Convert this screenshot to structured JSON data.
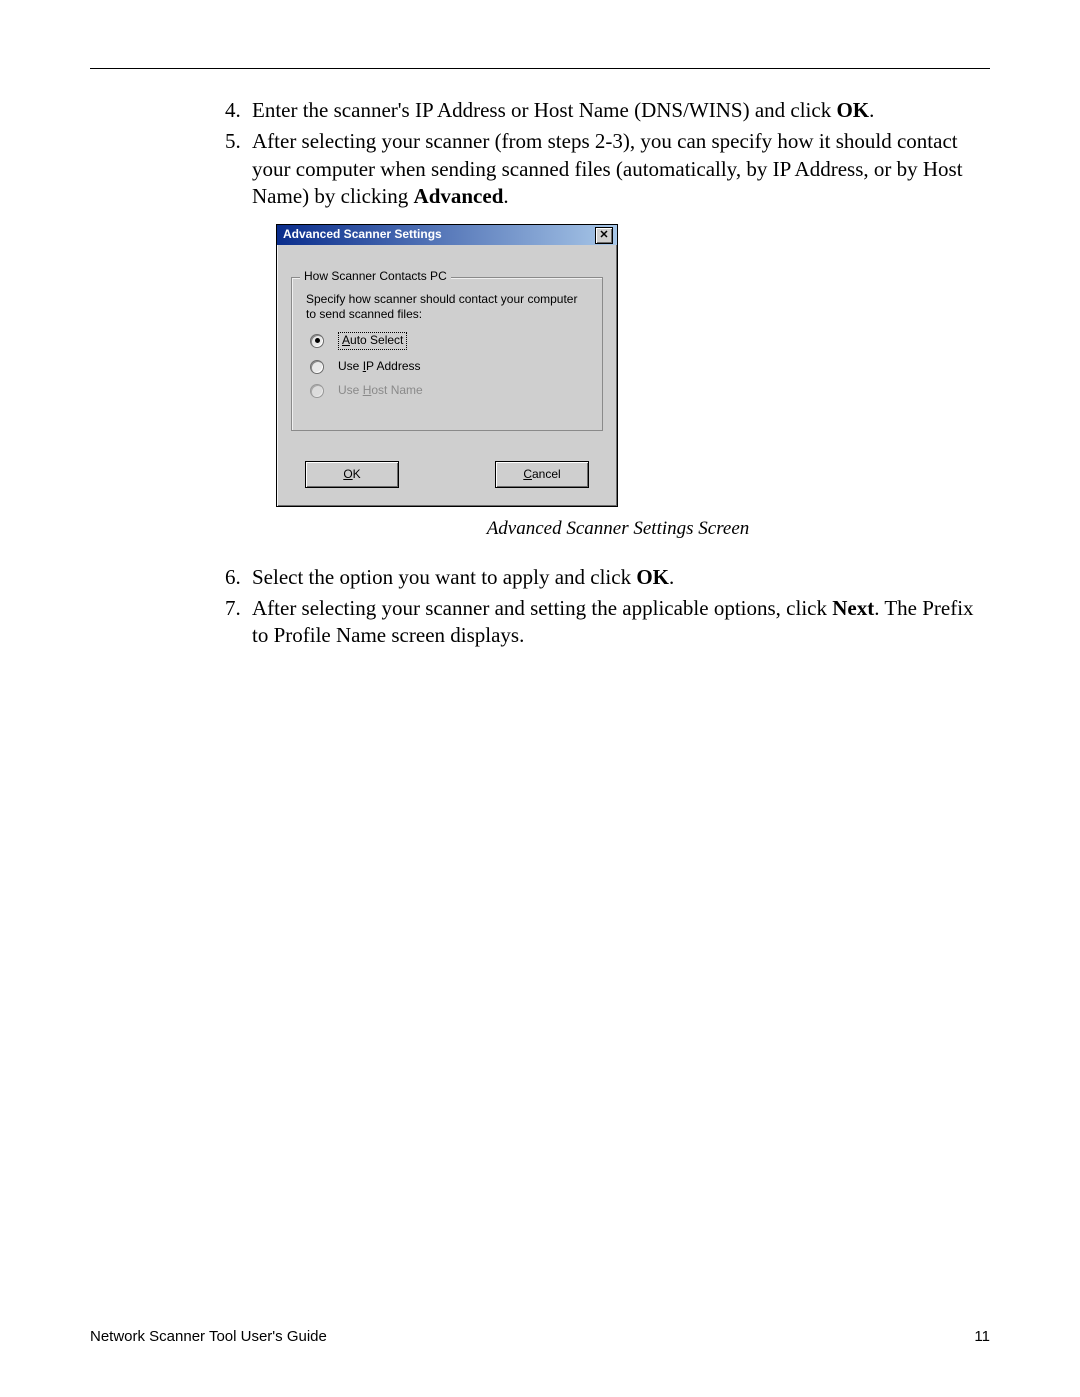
{
  "steps": {
    "s4": {
      "num": "4",
      "text_a": "Enter the scanner's IP Address or Host Name (DNS/WINS) and click ",
      "bold_a": "OK",
      "text_b": "."
    },
    "s5": {
      "num": "5",
      "text_a": "After selecting your scanner (from steps 2-3), you can specify how it should contact your computer when sending scanned files (automatically, by IP Address, or by Host Name) by clicking ",
      "bold_a": "Advanced",
      "text_b": "."
    },
    "s6": {
      "num": "6",
      "text_a": "Select the option you want to apply and click ",
      "bold_a": "OK",
      "text_b": "."
    },
    "s7": {
      "num": "7",
      "text_a": "After selecting your scanner and setting the applicable options, click ",
      "bold_a": "Next",
      "text_b": ". The Prefix to Profile Name screen displays."
    }
  },
  "dialog": {
    "title": "Advanced Scanner Settings",
    "close_glyph": "✕",
    "group_legend": "How Scanner Contacts PC",
    "group_desc": "Specify how scanner should contact your computer to send scanned files:",
    "opt1_u": "A",
    "opt1_rest": "uto Select",
    "opt2_pre": "Use ",
    "opt2_u": "I",
    "opt2_rest": "P Address",
    "opt3_pre": "Use ",
    "opt3_u": "H",
    "opt3_rest": "ost Name",
    "ok_u": "O",
    "ok_rest": "K",
    "cancel_u": "C",
    "cancel_rest": "ancel"
  },
  "caption": "Advanced Scanner Settings Screen",
  "footer": {
    "left": "Network Scanner Tool User's Guide",
    "right": "11"
  }
}
